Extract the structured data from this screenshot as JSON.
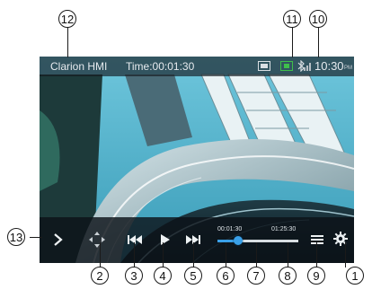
{
  "status_bar": {
    "app_name": "Clarion HMI",
    "elapsed_label": "Time:00:01:30",
    "clock": "10:30",
    "ampm": "PM"
  },
  "colors": {
    "accent": "#3aa0e8",
    "bar_bg": "#0c1218",
    "status_green": "#3fbf4a"
  },
  "controls": {
    "progress_start": "00:01:30",
    "progress_end": "01:25:30",
    "progress_fraction": 0.26,
    "icons": [
      "chevron-right-icon",
      "move-icon",
      "previous-track-icon",
      "play-icon",
      "next-track-icon",
      "menu-icon",
      "gear-icon"
    ]
  },
  "callouts": [
    "1",
    "2",
    "3",
    "4",
    "5",
    "6",
    "7",
    "8",
    "9",
    "10",
    "11",
    "12",
    "13"
  ]
}
